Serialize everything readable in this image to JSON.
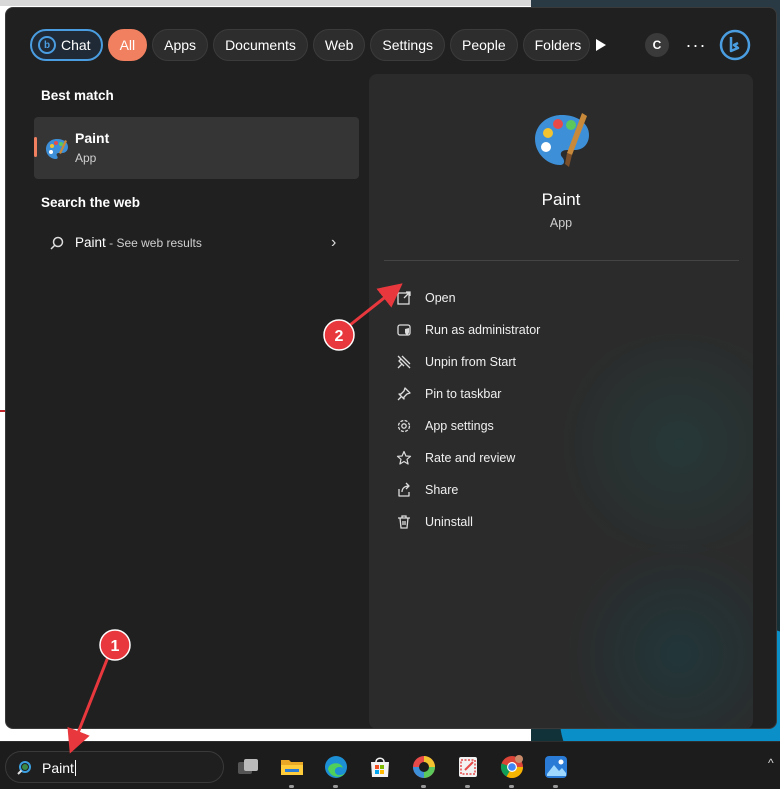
{
  "tabs": [
    {
      "label": "Chat"
    },
    {
      "label": "All"
    },
    {
      "label": "Apps"
    },
    {
      "label": "Documents"
    },
    {
      "label": "Web"
    },
    {
      "label": "Settings"
    },
    {
      "label": "People"
    },
    {
      "label": "Folders"
    }
  ],
  "toolbar": {
    "c_label": "C",
    "more_label": "···"
  },
  "best_match": {
    "heading": "Best match",
    "name": "Paint",
    "type": "App"
  },
  "search_web": {
    "heading": "Search the web",
    "query": "Paint",
    "suffix": " - See web results"
  },
  "detail": {
    "name": "Paint",
    "type": "App",
    "actions": [
      {
        "label": "Open",
        "icon": "open-external-icon"
      },
      {
        "label": "Run as administrator",
        "icon": "shield-admin-icon"
      },
      {
        "label": "Unpin from Start",
        "icon": "unpin-icon"
      },
      {
        "label": "Pin to taskbar",
        "icon": "pin-icon"
      },
      {
        "label": "App settings",
        "icon": "gear-icon"
      },
      {
        "label": "Rate and review",
        "icon": "star-icon"
      },
      {
        "label": "Share",
        "icon": "share-icon"
      },
      {
        "label": "Uninstall",
        "icon": "trash-icon"
      }
    ]
  },
  "taskbar": {
    "search_value": "Paint",
    "apps": [
      "task-view-icon",
      "file-explorer-icon",
      "edge-icon",
      "store-icon",
      "colorful-app-icon",
      "snipping-tool-icon",
      "chrome-icon",
      "photos-icon"
    ]
  },
  "annotations": [
    {
      "label": "1"
    },
    {
      "label": "2"
    }
  ],
  "colors": {
    "accent": "#f08060",
    "chat_border": "#4a9de0",
    "annotation_red": "#e8383d"
  }
}
